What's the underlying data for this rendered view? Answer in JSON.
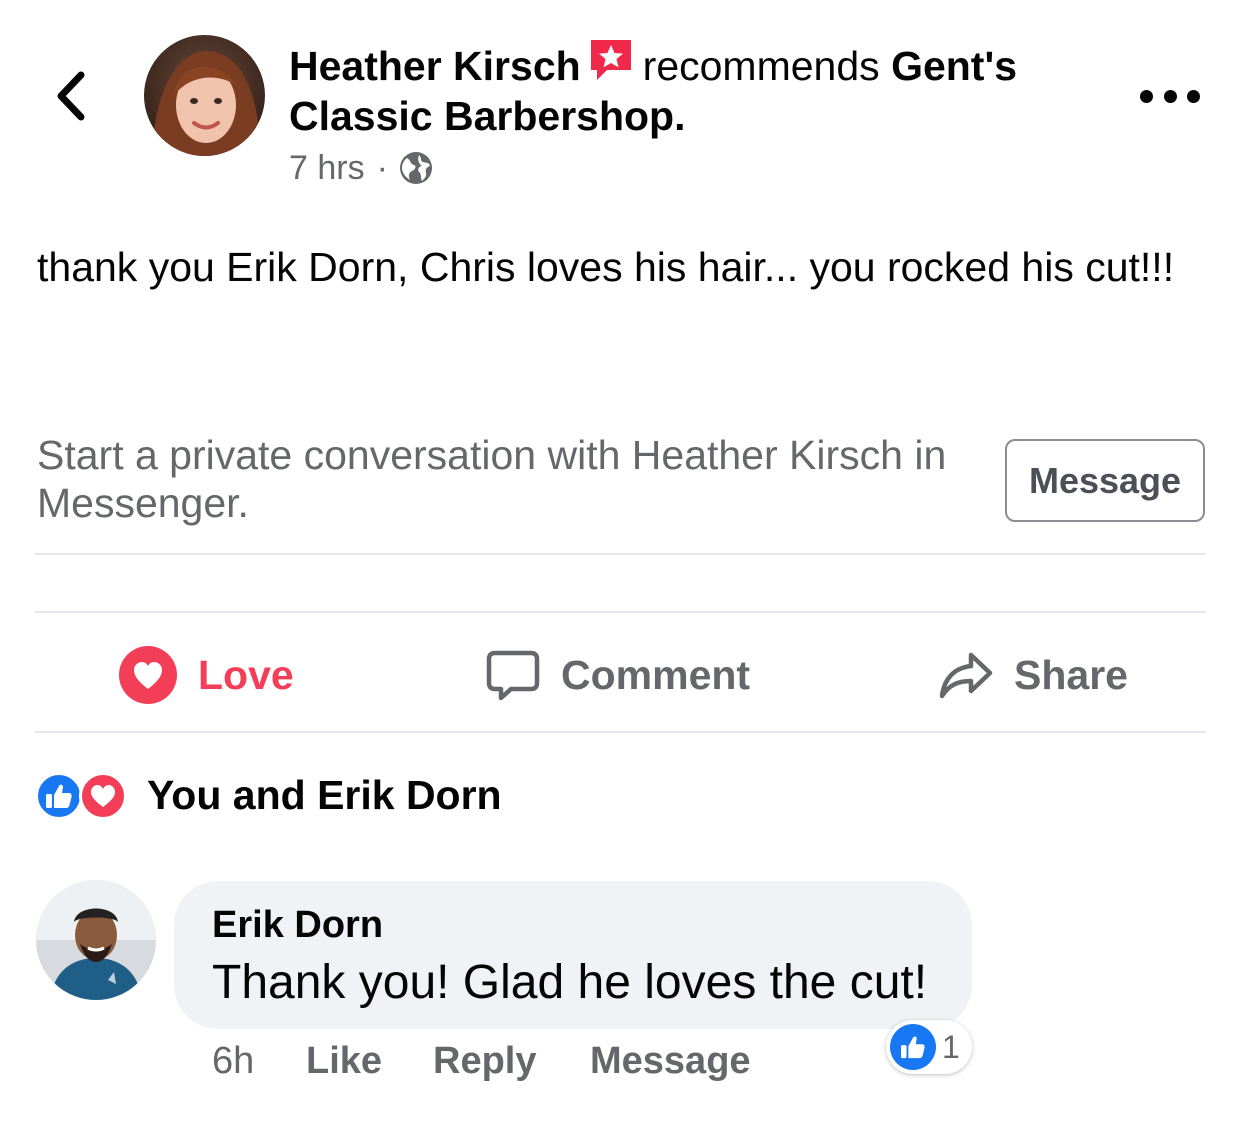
{
  "header": {
    "author_name": "Heather Kirsch",
    "verb": "recommends",
    "page_name": "Gent's Classic Barbershop.",
    "timestamp": "7 hrs",
    "separator": "·",
    "privacy_icon": "globe-icon",
    "recommend_icon": "recommend-star-icon",
    "more_icon": "more-horizontal-icon",
    "back_icon": "chevron-left-icon"
  },
  "post": {
    "text": "thank you Erik Dorn, Chris loves his hair... you rocked his cut!!!"
  },
  "messenger_prompt": {
    "text": "Start a private conversation with Heather Kirsch in Messenger.",
    "button_label": "Message"
  },
  "actions": {
    "love_label": "Love",
    "comment_label": "Comment",
    "share_label": "Share"
  },
  "reactions_summary": {
    "text": "You and Erik Dorn",
    "icons": [
      "like-icon",
      "love-icon"
    ]
  },
  "comment": {
    "author": "Erik Dorn",
    "text": "Thank you! Glad he loves the cut!",
    "time": "6h",
    "like_label": "Like",
    "reply_label": "Reply",
    "message_label": "Message",
    "reaction_count": "1"
  },
  "colors": {
    "love_red": "#f33e58",
    "like_blue": "#1877f2",
    "secondary_text": "#65676b",
    "bubble_bg": "#f0f2f5",
    "divider": "#e4e6eb"
  }
}
